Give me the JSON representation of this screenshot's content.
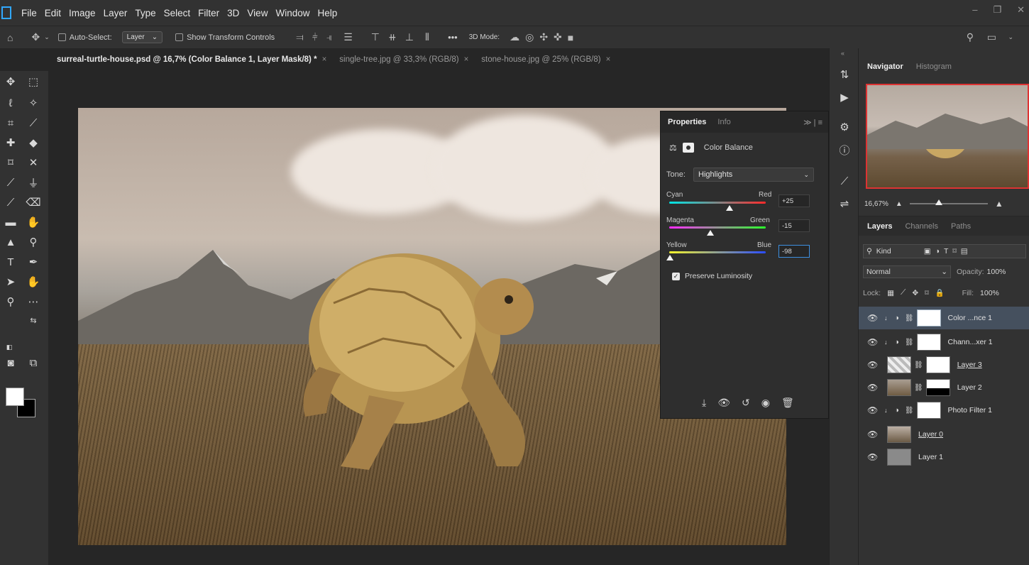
{
  "menu": {
    "items": [
      "File",
      "Edit",
      "Image",
      "Layer",
      "Type",
      "Select",
      "Filter",
      "3D",
      "View",
      "Window",
      "Help"
    ]
  },
  "options": {
    "auto_select_label": "Auto-Select:",
    "layer_select": "Layer",
    "show_transform_label": "Show Transform Controls",
    "mode_3d_label": "3D Mode:",
    "more_label": "•••"
  },
  "tabs": [
    {
      "label": "surreal-turtle-house.psd @ 16,7% (Color Balance 1, Layer Mask/8) *",
      "close": "×"
    },
    {
      "label": "single-tree.jpg @ 33,3% (RGB/8)",
      "close": "×"
    },
    {
      "label": "stone-house.jpg @ 25% (RGB/8)",
      "close": "×"
    }
  ],
  "properties": {
    "tab_properties": "Properties",
    "tab_info": "Info",
    "adjustment_name": "Color Balance",
    "tone_label": "Tone:",
    "tone_value": "Highlights",
    "sliders": [
      {
        "left": "Cyan",
        "right": "Red",
        "value": "+25",
        "position": 0.625
      },
      {
        "left": "Magenta",
        "right": "Green",
        "value": "-15",
        "position": 0.425
      },
      {
        "left": "Yellow",
        "right": "Blue",
        "value": "-98",
        "position": 0.01
      }
    ],
    "preserve_label": "Preserve Luminosity",
    "preserve_checked": true
  },
  "navigator": {
    "tab_navigator": "Navigator",
    "tab_histogram": "Histogram",
    "zoom": "16,67%"
  },
  "layers_panel": {
    "tab_layers": "Layers",
    "tab_channels": "Channels",
    "tab_paths": "Paths",
    "kind_label": "Kind",
    "blend_mode": "Normal",
    "opacity_label": "Opacity:",
    "opacity_value": "100%",
    "lock_label": "Lock:",
    "fill_label": "Fill:",
    "fill_value": "100%",
    "layers": [
      {
        "name": "Color ...nce 1",
        "type": "adjustment",
        "selected": true
      },
      {
        "name": "Chann...xer 1",
        "type": "adjustment",
        "selected": false
      },
      {
        "name": "Layer 3",
        "type": "pixel-mask",
        "selected": false
      },
      {
        "name": "Layer 2",
        "type": "pixel-mask",
        "selected": false
      },
      {
        "name": "Photo Filter 1",
        "type": "adjustment",
        "selected": false
      },
      {
        "name": "Layer 0",
        "type": "pixel",
        "selected": false
      },
      {
        "name": "Layer 1",
        "type": "pixel",
        "selected": false
      }
    ]
  },
  "colors": {
    "accent_blue": "#31a8ff",
    "panel_bg": "#323232",
    "selected_layer": "#45505e"
  }
}
